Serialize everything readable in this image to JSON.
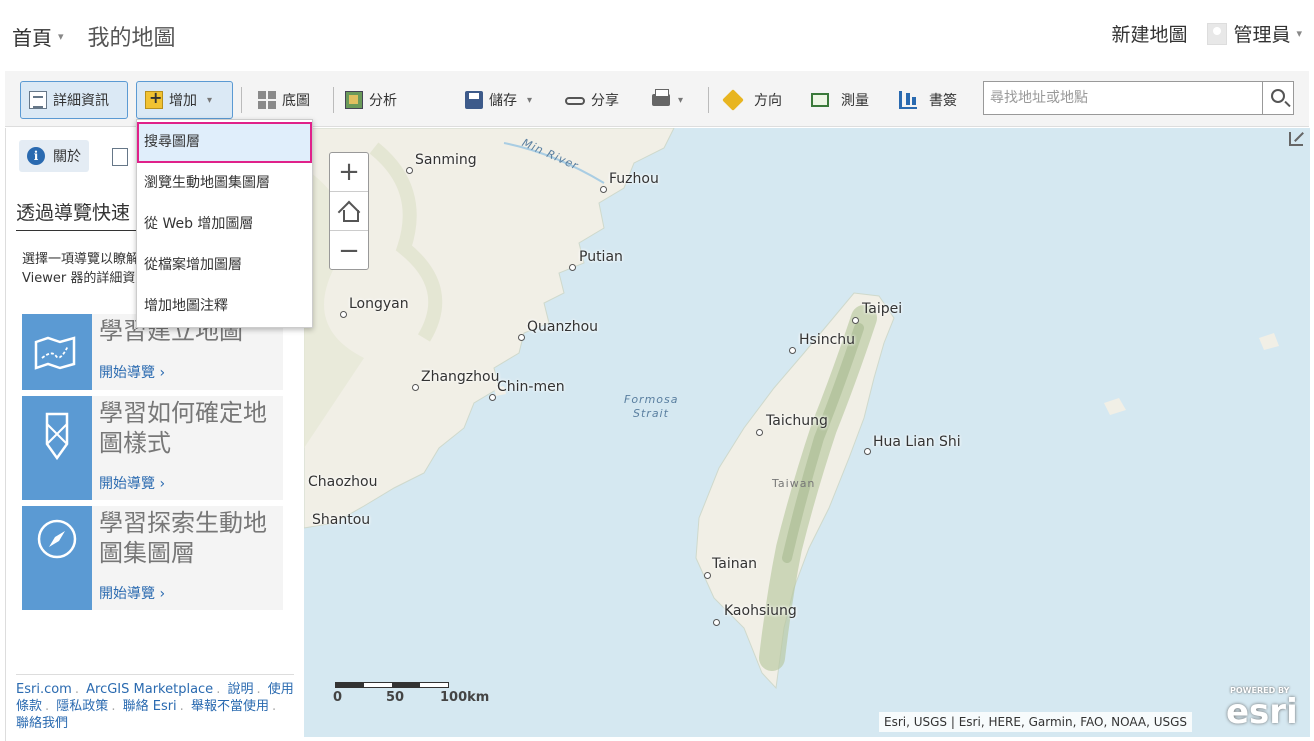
{
  "header": {
    "home_label": "首頁",
    "caret": "▾",
    "title": "我的地圖",
    "new_map": "新建地圖",
    "user": "管理員"
  },
  "toolbar": {
    "details": "詳細資訊",
    "add": "增加",
    "basemap": "底圖",
    "analysis": "分析",
    "save": "儲存",
    "share": "分享",
    "directions": "方向",
    "measure": "測量",
    "bookmarks": "書簽",
    "search_placeholder": "尋找地址或地點"
  },
  "add_menu": {
    "items": [
      "搜尋圖層",
      "瀏覽生動地圖集圖層",
      "從 Web 增加圖層",
      "從檔案增加圖層",
      "增加地圖注釋"
    ]
  },
  "side_panel": {
    "about_tab": "關於",
    "heading": "透過導覽快速",
    "description": "選擇一項導覽以瞭解更多 ArcGIS 的 Map Viewer 器的詳細資訊。",
    "cards": [
      {
        "title": "學習建立地圖",
        "link": "開始導覽 ›"
      },
      {
        "title": "學習如何確定地圖樣式",
        "link": "開始導覽 ›"
      },
      {
        "title": "學習探索生動地圖集圖層",
        "link": "開始導覽 ›"
      }
    ],
    "footer": [
      "Esri.com",
      "ArcGIS Marketplace",
      "說明",
      "使用條款",
      "隱私政策",
      "聯絡 Esri",
      "舉報不當使用",
      "聯絡我們"
    ]
  },
  "map": {
    "cities": [
      "Sanming",
      "Fuzhou",
      "Putian",
      "Longyan",
      "Quanzhou",
      "Zhangzhou",
      "Chin-men",
      "Chaozhou",
      "Shantou",
      "Taipei",
      "Hsinchu",
      "Taichung",
      "Hua Lian Shi",
      "Tainan",
      "Kaohsiung"
    ],
    "water_labels": [
      "Min River",
      "Formosa",
      "Strait"
    ],
    "land_label": "Taiwan",
    "zoom_in": "+",
    "zoom_out": "−",
    "scale": [
      "0",
      "50",
      "100km"
    ],
    "attribution": "Esri, USGS | Esri, HERE, Garmin, FAO, NOAA, USGS",
    "logo_powered": "POWERED BY",
    "logo_word": "esri"
  },
  "colors": {
    "accent": "#5b9ad3",
    "highlight_border": "#e0218a",
    "link": "#2a6ab0",
    "water": "#d5e8f1",
    "land": "#f1efe6"
  }
}
